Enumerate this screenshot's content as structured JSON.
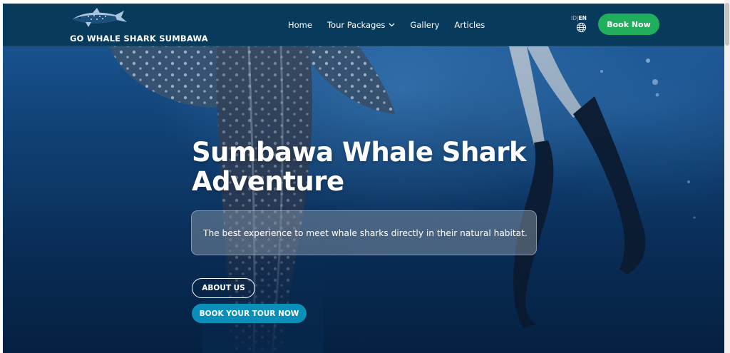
{
  "brand": {
    "name": "GO WHALE SHARK SUMBAWA",
    "logo_icon": "whale-shark-logo-icon"
  },
  "nav": {
    "items": [
      {
        "label": "Home"
      },
      {
        "label": "Tour Packages",
        "has_dropdown": true
      },
      {
        "label": "Gallery"
      },
      {
        "label": "Articles"
      }
    ],
    "language": {
      "id": "ID",
      "separator": "|",
      "en": "EN",
      "active": "EN",
      "icon": "globe-icon"
    },
    "cta_label": "Book Now"
  },
  "hero": {
    "title_line1": "Sumbawa Whale Shark",
    "title_line2": "Adventure",
    "subtitle": "The best experience to meet whale sharks directly in their natural habitat.",
    "about_label": "ABOUT US",
    "book_tour_label": "BOOK YOUR TOUR NOW"
  },
  "colors": {
    "navbar": "#073a5b",
    "cta_green": "#1faf5c",
    "book_tour_blue": "#0a8fb8",
    "ocean_deep": "#082a52",
    "ocean_light": "#1e5fa3"
  }
}
